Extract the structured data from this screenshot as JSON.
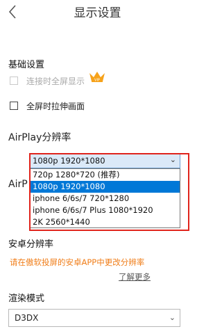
{
  "header": {
    "title": "显示设置",
    "back_icon": "back-chevron-icon"
  },
  "basic": {
    "label": "基础设置",
    "options": [
      {
        "label": "连接时全屏显示",
        "checked": false,
        "disabled": true,
        "badge": "VIP"
      },
      {
        "label": "全屏时拉伸画面",
        "checked": false,
        "disabled": false
      }
    ]
  },
  "airplay": {
    "label": "AirPlay分辨率",
    "hidden_label_fragment": "AirP",
    "selected": "1080p 1920*1080",
    "options": [
      "720p 1280*720 (推荐)",
      "1080p 1920*1080",
      "iphone 6/6s/7 720*1280",
      "iphone 6/6s/7 Plus 1080*1920",
      "2K 2560*1440"
    ],
    "selected_index": 1
  },
  "android": {
    "label": "安卓分辨率",
    "notice": "请在傲软投屏的安卓APP中更改分辨率",
    "learn_more": "了解更多"
  },
  "render": {
    "label": "渲染模式",
    "value": "D3DX"
  },
  "colors": {
    "accent": "#0078d7",
    "highlight_frame": "#e0241c",
    "notice": "#f07d18"
  }
}
